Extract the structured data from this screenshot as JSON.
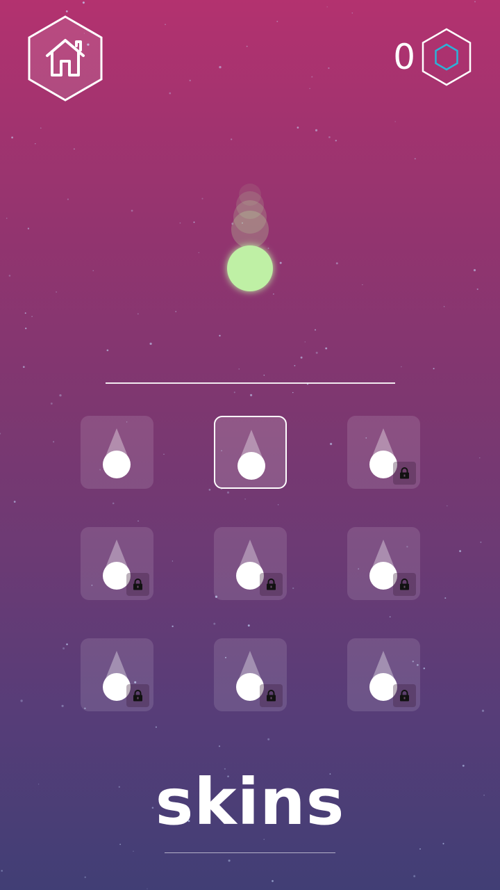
{
  "header": {
    "home_icon": "home-icon",
    "coin_count": "0",
    "coin_icon": "hexagon-coin-icon",
    "coin_color": "#2bb3d8"
  },
  "preview": {
    "ball_color": "#bff0a5"
  },
  "skins": [
    {
      "shape": "drop",
      "locked": false,
      "selected": false
    },
    {
      "shape": "drop",
      "locked": false,
      "selected": true
    },
    {
      "shape": "drop",
      "locked": true,
      "selected": false
    },
    {
      "shape": "drop",
      "locked": true,
      "selected": false
    },
    {
      "shape": "drop",
      "locked": true,
      "selected": false
    },
    {
      "shape": "drop",
      "locked": true,
      "selected": false
    },
    {
      "shape": "drop",
      "locked": true,
      "selected": false
    },
    {
      "shape": "drop",
      "locked": true,
      "selected": false
    },
    {
      "shape": "drop",
      "locked": true,
      "selected": false
    }
  ],
  "lock_icon": "lock-icon",
  "title": "skins"
}
